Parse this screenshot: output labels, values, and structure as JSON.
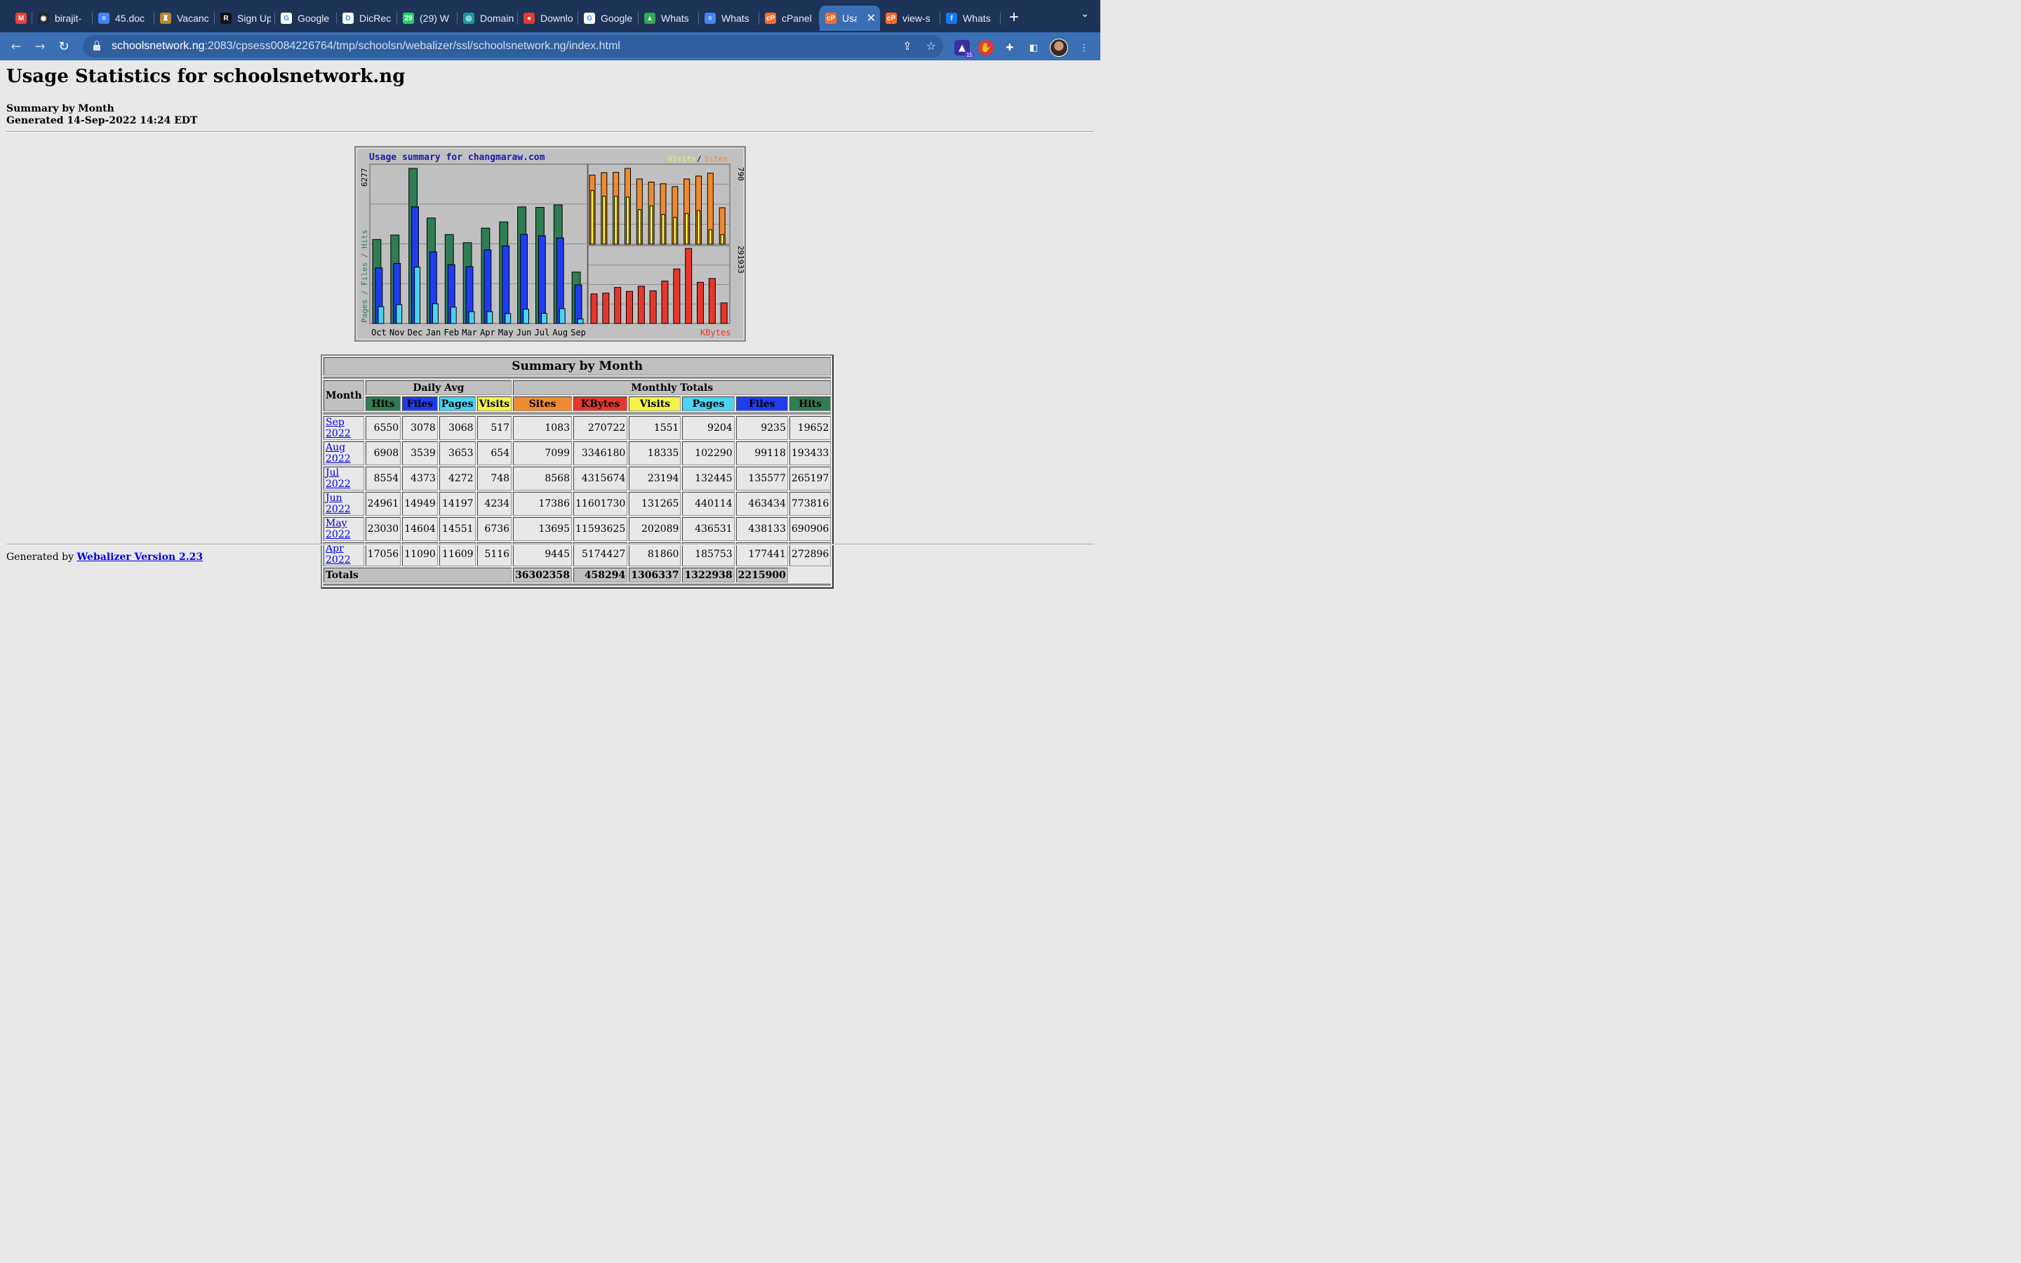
{
  "tabs": [
    {
      "label": "",
      "icon": "gmail-icon",
      "color": "#ea4335",
      "glyph": "M"
    },
    {
      "label": "birajit-",
      "icon": "github-icon",
      "color": "#24292e",
      "glyph": "◉"
    },
    {
      "label": "45.doc",
      "icon": "google-docs-icon",
      "color": "#4285f4",
      "glyph": "≡"
    },
    {
      "label": "Vacanc",
      "icon": "emblem-icon",
      "color": "#b8892f",
      "glyph": "♜"
    },
    {
      "label": "Sign Up",
      "icon": "r-logo-icon",
      "color": "#111111",
      "glyph": "R"
    },
    {
      "label": "Google",
      "icon": "google-icon",
      "color": "#ffffff",
      "glyph": "G"
    },
    {
      "label": "DicRec",
      "icon": "dic-icon",
      "color": "#ffffff",
      "glyph": "D"
    },
    {
      "label": "(29) W",
      "icon": "whatsapp-icon",
      "color": "#25d366",
      "glyph": "29"
    },
    {
      "label": "Domain",
      "icon": "domain-icon",
      "color": "#1a9aa0",
      "glyph": "◎"
    },
    {
      "label": "Downlo",
      "icon": "download-icon",
      "color": "#e53935",
      "glyph": "●"
    },
    {
      "label": "Google",
      "icon": "google-icon",
      "color": "#ffffff",
      "glyph": "G"
    },
    {
      "label": "Whats",
      "icon": "google-drive-icon",
      "color": "#34a853",
      "glyph": "▲"
    },
    {
      "label": "Whats",
      "icon": "google-docs-icon",
      "color": "#4285f4",
      "glyph": "≡"
    },
    {
      "label": "cPanel",
      "icon": "cpanel-icon",
      "color": "#ff6c2c",
      "glyph": "cP"
    },
    {
      "label": "Usa",
      "icon": "cpanel-icon",
      "color": "#ff6c2c",
      "glyph": "cP",
      "active": true
    },
    {
      "label": "view-s",
      "icon": "cpanel-icon",
      "color": "#ff6c2c",
      "glyph": "cP"
    },
    {
      "label": "Whats",
      "icon": "facebook-icon",
      "color": "#1877f2",
      "glyph": "f"
    }
  ],
  "browser": {
    "url_host": "schoolsnetwork.ng",
    "url_path": ":2083/cpsess0084226764/tmp/schoolsn/webalizer/ssl/schoolsnetwork.ng/index.html",
    "ext_badge": "15"
  },
  "page": {
    "title": "Usage Statistics for schoolsnetwork.ng",
    "subtitle_line1": "Summary by Month",
    "subtitle_line2": "Generated 14-Sep-2022 14:24 EDT",
    "footer_prefix": "Generated by",
    "footer_link": "Webalizer Version 2.23"
  },
  "colors": {
    "hits": "#2f7d52",
    "files": "#1f3cf0",
    "pages": "#48d4f2",
    "visits": "#f4f44a",
    "sites": "#ef8a30",
    "kbytes": "#e8362a",
    "panel": "#c0c0c0"
  },
  "chart_data": {
    "type": "bar",
    "title": "Usage summary for changmaraw.com",
    "categories": [
      "Oct",
      "Nov",
      "Dec",
      "Jan",
      "Feb",
      "Mar",
      "Apr",
      "May",
      "Jun",
      "Jul",
      "Aug",
      "Sep"
    ],
    "left_panel": {
      "axis_label": "Pages / Files / Hits",
      "max_label": "6277",
      "ymax": 6277,
      "series": [
        {
          "name": "Hits",
          "values": [
            3400,
            3580,
            6277,
            4270,
            3600,
            3270,
            3860,
            4110,
            4720,
            4700,
            4800,
            2080
          ]
        },
        {
          "name": "Files",
          "values": [
            2250,
            2430,
            4720,
            2900,
            2380,
            2300,
            2980,
            3140,
            3610,
            3550,
            3460,
            1560
          ]
        },
        {
          "name": "Pages",
          "values": [
            680,
            760,
            2280,
            800,
            660,
            480,
            480,
            400,
            580,
            410,
            600,
            180
          ]
        }
      ]
    },
    "top_right_panel": {
      "legend": [
        "Visits",
        "Sites"
      ],
      "max_label": "790",
      "ymax": 790,
      "series": [
        {
          "name": "Sites",
          "values": [
            720,
            745,
            748,
            790,
            680,
            648,
            630,
            600,
            680,
            710,
            740,
            380
          ]
        },
        {
          "name": "Visits",
          "values": [
            560,
            500,
            500,
            490,
            360,
            400,
            310,
            280,
            320,
            350,
            150,
            100
          ]
        }
      ]
    },
    "bottom_right_panel": {
      "legend": [
        "KBytes"
      ],
      "max_label": "291933",
      "ymax": 291933,
      "series": [
        {
          "name": "KBytes",
          "values": [
            115000,
            118000,
            140000,
            125000,
            145000,
            127000,
            165000,
            212000,
            291933,
            160000,
            175000,
            80000
          ]
        }
      ]
    }
  },
  "table": {
    "title": "Summary by Month",
    "month_header": "Month",
    "daily_avg_header": "Daily Avg",
    "monthly_totals_header": "Monthly Totals",
    "daily_cols": [
      "Hits",
      "Files",
      "Pages",
      "Visits"
    ],
    "monthly_cols": [
      "Sites",
      "KBytes",
      "Visits",
      "Pages",
      "Files",
      "Hits"
    ],
    "rows": [
      {
        "month": "Sep 2022",
        "daily": [
          "6550",
          "3078",
          "3068",
          "517"
        ],
        "monthly": [
          "1083",
          "270722",
          "1551",
          "9204",
          "9235",
          "19652"
        ]
      },
      {
        "month": "Aug 2022",
        "daily": [
          "6908",
          "3539",
          "3653",
          "654"
        ],
        "monthly": [
          "7099",
          "3346180",
          "18335",
          "102290",
          "99118",
          "193433"
        ]
      },
      {
        "month": "Jul 2022",
        "daily": [
          "8554",
          "4373",
          "4272",
          "748"
        ],
        "monthly": [
          "8568",
          "4315674",
          "23194",
          "132445",
          "135577",
          "265197"
        ]
      },
      {
        "month": "Jun 2022",
        "daily": [
          "24961",
          "14949",
          "14197",
          "4234"
        ],
        "monthly": [
          "17386",
          "11601730",
          "131265",
          "440114",
          "463434",
          "773816"
        ]
      },
      {
        "month": "May 2022",
        "daily": [
          "23030",
          "14604",
          "14551",
          "6736"
        ],
        "monthly": [
          "13695",
          "11593625",
          "202089",
          "436531",
          "438133",
          "690906"
        ]
      },
      {
        "month": "Apr 2022",
        "daily": [
          "17056",
          "11090",
          "11609",
          "5116"
        ],
        "monthly": [
          "9445",
          "5174427",
          "81860",
          "185753",
          "177441",
          "272896"
        ]
      }
    ],
    "totals_label": "Totals",
    "totals": [
      "36302358",
      "458294",
      "1306337",
      "1322938",
      "2215900"
    ]
  }
}
